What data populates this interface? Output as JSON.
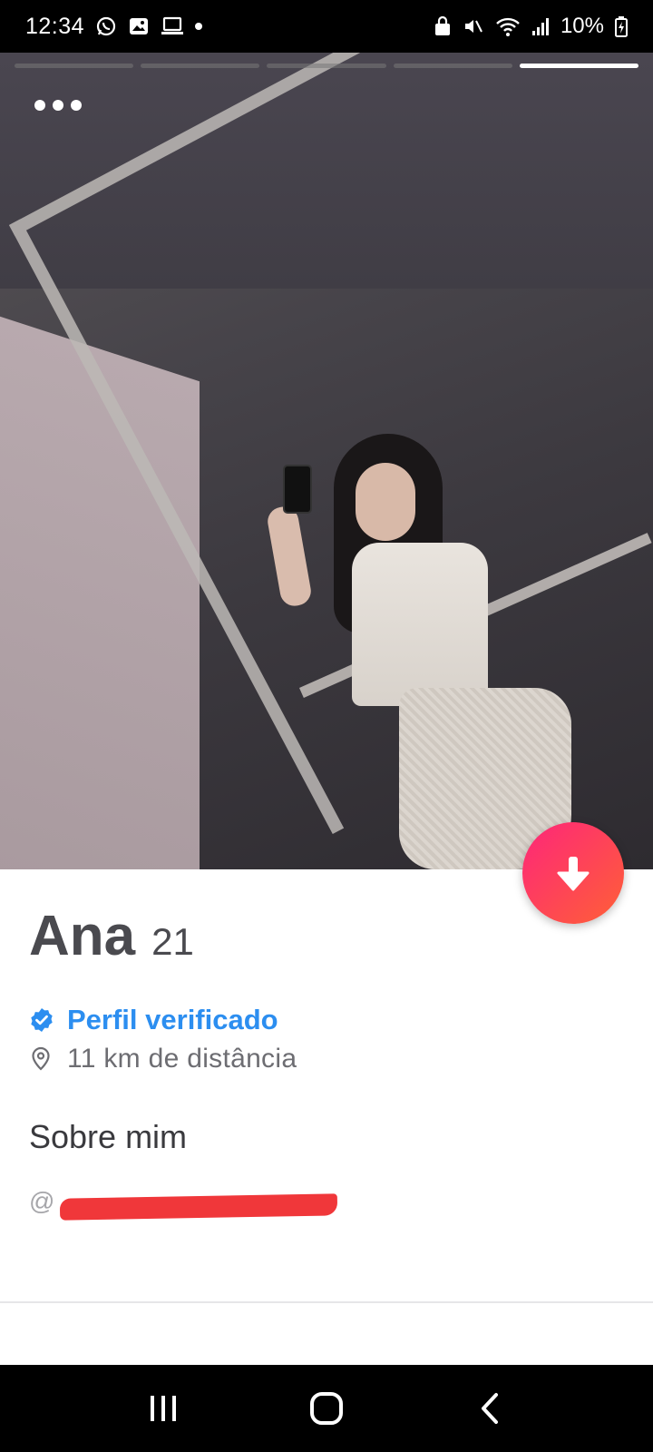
{
  "status_bar": {
    "time": "12:34",
    "battery_percent": "10%",
    "left_icons": [
      "whatsapp-icon",
      "gallery-icon",
      "laptop-icon",
      "dot-icon"
    ],
    "right_icons": [
      "vpn-lock-icon",
      "mute-icon",
      "wifi-icon",
      "signal-icon",
      "battery-charging-icon"
    ]
  },
  "photo": {
    "photo_count": 5,
    "active_photo_index": 4
  },
  "profile": {
    "name": "Ana",
    "age": "21",
    "verified_label": "Perfil verificado",
    "distance": "11 km de distância",
    "about_title": "Sobre mim",
    "about_handle_prefix": "@"
  },
  "colors": {
    "verified_blue": "#2c8ef0",
    "brand_gradient_start": "#fd267a",
    "brand_gradient_end": "#ff6036",
    "redaction_red": "#f0373a"
  },
  "nav_bar": {
    "icons": [
      "recents-icon",
      "home-icon",
      "back-icon"
    ]
  }
}
